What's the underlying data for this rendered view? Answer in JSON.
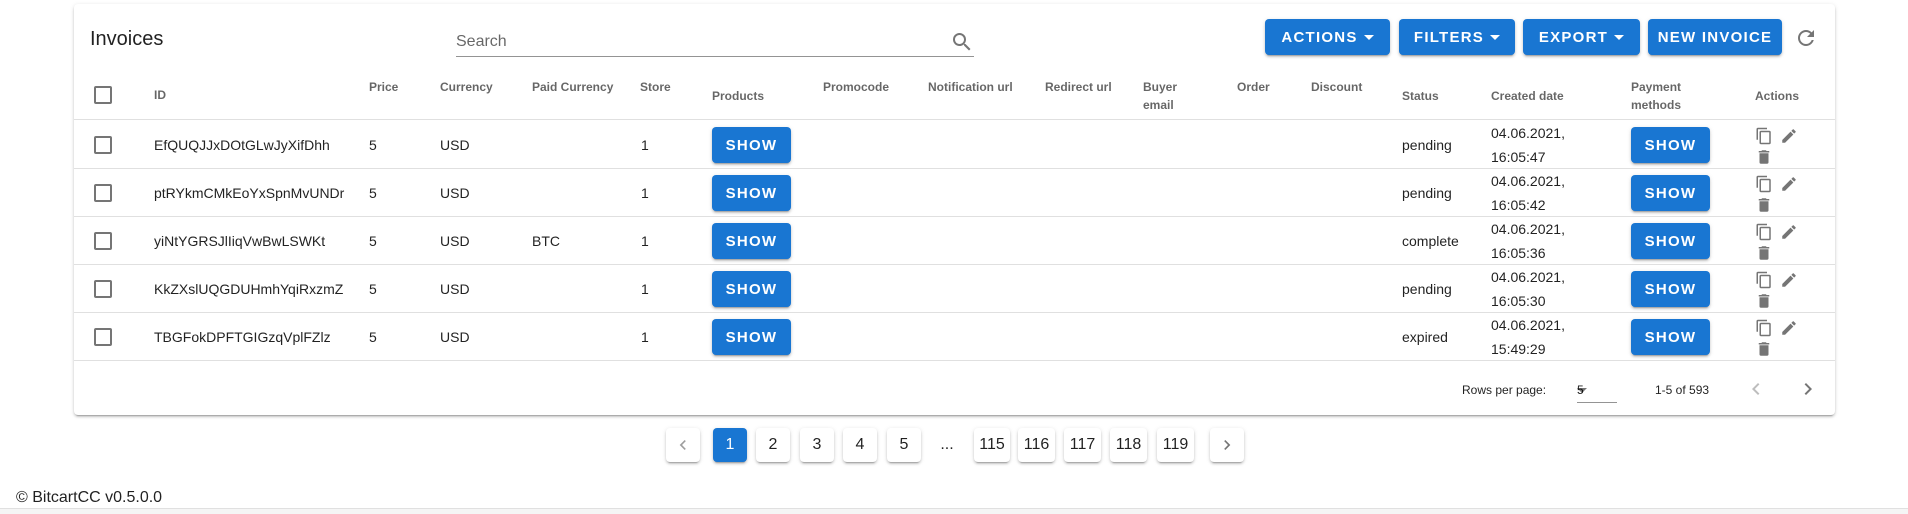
{
  "toolbar": {
    "title": "Invoices",
    "search_placeholder": "Search",
    "actions_label": "ACTIONS",
    "filters_label": "FILTERS",
    "export_label": "EXPORT",
    "new_invoice_label": "NEW INVOICE"
  },
  "columns": {
    "id": "ID",
    "price": "Price",
    "currency": "Currency",
    "paid_currency": "Paid Currency",
    "store": "Store",
    "products": "Products",
    "promocode": "Promocode",
    "notification_url": "Notification url",
    "redirect_url": "Redirect url",
    "buyer_email_1": "Buyer",
    "buyer_email_2": "email",
    "order": "Order",
    "discount": "Discount",
    "status": "Status",
    "created_date": "Created date",
    "payment_methods_1": "Payment",
    "payment_methods_2": "methods",
    "actions": "Actions"
  },
  "rows": [
    {
      "id": "EfQUQJJxDOtGLwJyXifDhh",
      "price": "5",
      "currency": "USD",
      "paid_currency": "",
      "store": "1",
      "products": "SHOW",
      "status": "pending",
      "date": "04.06.2021,",
      "time": "16:05:47",
      "payment_methods": "SHOW"
    },
    {
      "id": "ptRYkmCMkEoYxSpnMvUNDr",
      "price": "5",
      "currency": "USD",
      "paid_currency": "",
      "store": "1",
      "products": "SHOW",
      "status": "pending",
      "date": "04.06.2021,",
      "time": "16:05:42",
      "payment_methods": "SHOW"
    },
    {
      "id": "yiNtYGRSJlIiqVwBwLSWKt",
      "price": "5",
      "currency": "USD",
      "paid_currency": "BTC",
      "store": "1",
      "products": "SHOW",
      "status": "complete",
      "date": "04.06.2021,",
      "time": "16:05:36",
      "payment_methods": "SHOW"
    },
    {
      "id": "KkZXslUQGDUHmhYqiRxzmZ",
      "price": "5",
      "currency": "USD",
      "paid_currency": "",
      "store": "1",
      "products": "SHOW",
      "status": "pending",
      "date": "04.06.2021,",
      "time": "16:05:30",
      "payment_methods": "SHOW"
    },
    {
      "id": "TBGFokDPFTGIGzqVplFZlz",
      "price": "5",
      "currency": "USD",
      "paid_currency": "",
      "store": "1",
      "products": "SHOW",
      "status": "expired",
      "date": "04.06.2021,",
      "time": "15:49:29",
      "payment_methods": "SHOW"
    }
  ],
  "footer": {
    "rows_per_page_label": "Rows per page:",
    "rows_per_page_value": "5",
    "range": "1-5 of 593"
  },
  "pagination": {
    "pages": [
      "1",
      "2",
      "3",
      "4",
      "5",
      "115",
      "116",
      "117",
      "118",
      "119"
    ],
    "ellipsis": "...",
    "current": "1"
  },
  "copyright": "© BitcartCC v0.5.0.0",
  "colors": {
    "primary": "#1976d2"
  },
  "icons": {
    "search": "magnify-icon",
    "refresh": "refresh-icon",
    "copy": "content-copy-icon",
    "edit": "pencil-icon",
    "delete": "delete-icon",
    "prev": "chevron-left-icon",
    "next": "chevron-right-icon"
  }
}
